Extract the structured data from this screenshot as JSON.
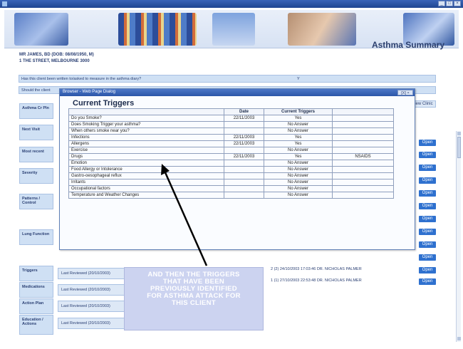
{
  "window": {
    "title": "",
    "buttons": [
      "_",
      "□",
      "×"
    ]
  },
  "header": {
    "page_title": "Asthma Summary"
  },
  "patient": {
    "name_line": "MR JAMES, BD (DOB: 08/08/1950, M)",
    "address_line": "1 THE STREET, MELBOURNE 3000"
  },
  "questions": [
    {
      "text": "Has this client been written to/asked to measure in the asthma diary?",
      "answer": "Y"
    },
    {
      "text": "Should the client",
      "answer": ""
    }
  ],
  "sidebar": {
    "items": [
      {
        "label": "Asthma Cr Pln"
      },
      {
        "label": "Next Visit"
      },
      {
        "label": "Most recent"
      },
      {
        "label": "Severity"
      },
      {
        "label": "Patterns / Control"
      },
      {
        "label": "Lung Function"
      },
      {
        "label": "Triggers"
      },
      {
        "label": "Medications"
      },
      {
        "label": "Action Plan"
      },
      {
        "label": "Education / Actions"
      }
    ]
  },
  "reviews": [
    {
      "text": "Last Reviewed (20/10/2003)"
    },
    {
      "text": "Last Reviewed (20/10/2003)"
    },
    {
      "text": "Last Reviewed (20/10/2003)"
    },
    {
      "text": "Last Reviewed (20/10/2003)"
    }
  ],
  "view_button": "View Clinic",
  "open_label": "Open",
  "log_rows": [
    {
      "text": "2 (2)  24/10/2003 17:03:46  DR. NICHOLAS PALMER"
    },
    {
      "text": "1 (1)  27/10/2003 22:53:48  DR. NICHOLAS PALMER"
    }
  ],
  "dialog": {
    "title": "Browser - Web Page Dialog",
    "close": "[X] ×",
    "heading": "Current Triggers",
    "columns": [
      "",
      "Date",
      "Current Triggers",
      ""
    ],
    "rows": [
      {
        "trigger": "Do you Smoke?",
        "date": "22/11/2003",
        "status": "Yes",
        "extra": ""
      },
      {
        "trigger": "Does Smoking Trigger your asthma?",
        "date": "",
        "status": "No Answer",
        "extra": ""
      },
      {
        "trigger": "When others smoke near you?",
        "date": "",
        "status": "No Answer",
        "extra": ""
      },
      {
        "trigger": "Infections",
        "date": "22/11/2003",
        "status": "Yes",
        "extra": ""
      },
      {
        "trigger": "Allergens",
        "date": "22/11/2003",
        "status": "Yes",
        "extra": ""
      },
      {
        "trigger": "Exercise",
        "date": "",
        "status": "No Answer",
        "extra": ""
      },
      {
        "trigger": "Drugs",
        "date": "22/11/2003",
        "status": "Yes",
        "extra": "NSAIDS"
      },
      {
        "trigger": "Emotion",
        "date": "",
        "status": "No Answer",
        "extra": ""
      },
      {
        "trigger": "Food Allergy or Intolerance",
        "date": "",
        "status": "No Answer",
        "extra": ""
      },
      {
        "trigger": "Gastro-oesophageal reflux",
        "date": "",
        "status": "No Answer",
        "extra": ""
      },
      {
        "trigger": "Irritants",
        "date": "",
        "status": "No Answer",
        "extra": ""
      },
      {
        "trigger": "Occupational factors",
        "date": "",
        "status": "No Answer",
        "extra": ""
      },
      {
        "trigger": "Temperature and Weather Changes",
        "date": "",
        "status": "No Answer",
        "extra": ""
      }
    ]
  },
  "callout": {
    "lines": [
      "AND THEN THE TRIGGERS",
      "THAT HAVE BEEN",
      "PREVIOUSLY IDENTIFIED",
      "FOR ASTHMA ATTACK FOR",
      "THIS CLIENT"
    ]
  }
}
